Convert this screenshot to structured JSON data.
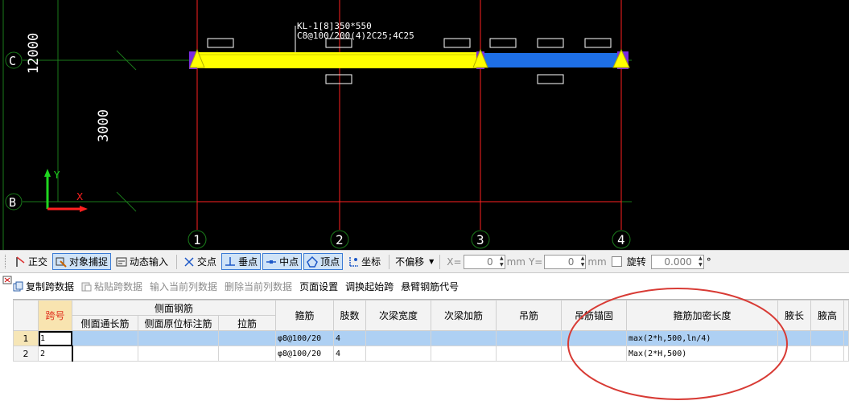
{
  "cad": {
    "axis_left_labels": {
      "top_dim": "12000",
      "mid_dim": "3000",
      "row_c": "C",
      "row_b": "B"
    },
    "column_labels": [
      "1",
      "2",
      "3",
      "4"
    ],
    "beam_annotation": {
      "line1": "KL-1[8]350*550",
      "line2": "C8@100/200(4)2C25;4C25"
    },
    "ucs": {
      "y": "Y",
      "x": "X"
    }
  },
  "toolbar": {
    "ortho": "正交",
    "snap": "对象捕捉",
    "dynamic_input": "动态输入",
    "intersection": "交点",
    "perpendicular": "垂点",
    "midpoint": "中点",
    "vertex": "顶点",
    "coordinate": "坐标",
    "offset_select": "不偏移",
    "x_label": "X=",
    "x_value": "0",
    "y_label": "Y=",
    "y_value": "0",
    "unit": "mm",
    "rotate_label": "旋转",
    "rotate_value": "0.000",
    "degree": "°"
  },
  "actions": {
    "copy": "复制跨数据",
    "paste": "粘贴跨数据",
    "input_current_column": "输入当前列数据",
    "delete_current_column": "删除当前列数据",
    "page_setup": "页面设置",
    "swap_start_span": "调换起始跨",
    "cantilever_code": "悬臂钢筋代号"
  },
  "table": {
    "headers": {
      "span_no": "跨号",
      "side_rebar": "侧面钢筋",
      "side_through": "侧面通长筋",
      "side_original": "侧面原位标注筋",
      "tie": "拉筋",
      "stirrup": "箍筋",
      "legs": "肢数",
      "secondary_width": "次梁宽度",
      "secondary_add": "次梁加筋",
      "hanger": "吊筋",
      "hanger_anchor": "吊筋锚固",
      "dense_length": "箍筋加密长度",
      "haunch_length": "腋长",
      "haunch_height": "腋高"
    },
    "rows": [
      {
        "rownum": "1",
        "span": "1",
        "stirrup": "φ8@100/20",
        "legs": "4",
        "dense_length": "max(2*h,500,ln/4)"
      },
      {
        "rownum": "2",
        "span": "2",
        "stirrup": "φ8@100/20",
        "legs": "4",
        "dense_length": "Max(2*H,500)"
      }
    ]
  },
  "colors": {
    "beam_yellow": "#ffff00",
    "beam_blue": "#1e6fe6",
    "grid_red": "#ff2020",
    "grid_green": "#1a7a1a",
    "annotation_ellipse": "#d83b35",
    "selected_row": "#aed0f3"
  }
}
